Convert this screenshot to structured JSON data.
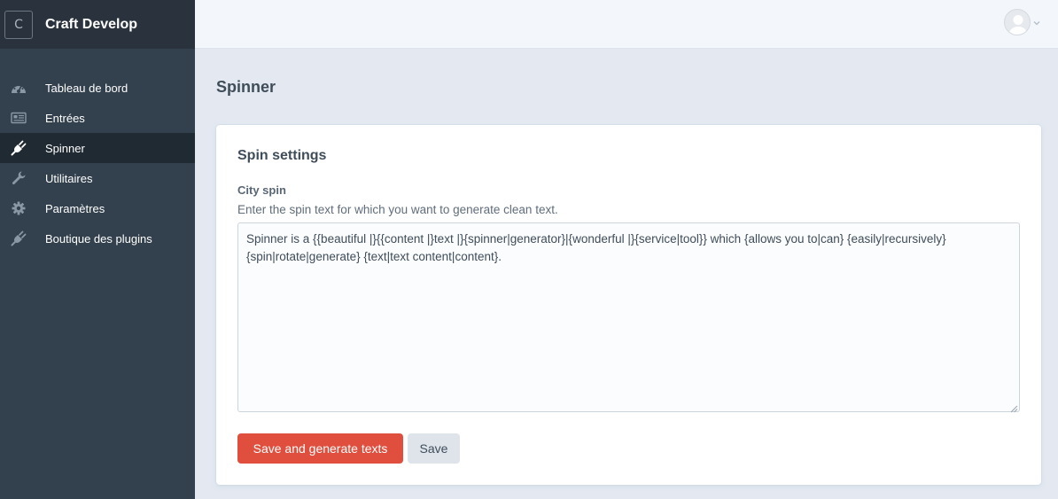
{
  "site": {
    "logo_letter": "C",
    "name": "Craft Develop"
  },
  "nav": {
    "items": [
      {
        "label": "Tableau de bord",
        "icon": "dashboard-gauge-icon",
        "selected": false
      },
      {
        "label": "Entrées",
        "icon": "newspaper-icon",
        "selected": false
      },
      {
        "label": "Spinner",
        "icon": "plugin-plug-icon",
        "selected": true
      },
      {
        "label": "Utilitaires",
        "icon": "wrench-icon",
        "selected": false
      },
      {
        "label": "Paramètres",
        "icon": "gear-icon",
        "selected": false
      },
      {
        "label": "Boutique des plugins",
        "icon": "plug-icon",
        "selected": false
      }
    ]
  },
  "user_menu": {
    "avatar_icon": "user-avatar-icon",
    "chevron_icon": "chevron-down-icon"
  },
  "page": {
    "title": "Spinner"
  },
  "form": {
    "section_title": "Spin settings",
    "field_label": "City spin",
    "field_instructions": "Enter the spin text for which you want to generate clean text.",
    "field_value": "Spinner is a {{beautiful |}{{content |}text |}{spinner|generator}|{wonderful |}{service|tool}} which {allows you to|can} {easily|recursively} {spin|rotate|generate} {text|text content|content}."
  },
  "buttons": {
    "primary": "Save and generate texts",
    "secondary": "Save"
  },
  "colors": {
    "sidebar_bg": "#33404d",
    "sidebar_header_bg": "#29323d",
    "selected_nav_bg": "#202a33",
    "page_bg": "#e4e9f1",
    "primary_button": "#e04f3e",
    "secondary_button": "#dfe4eb"
  }
}
